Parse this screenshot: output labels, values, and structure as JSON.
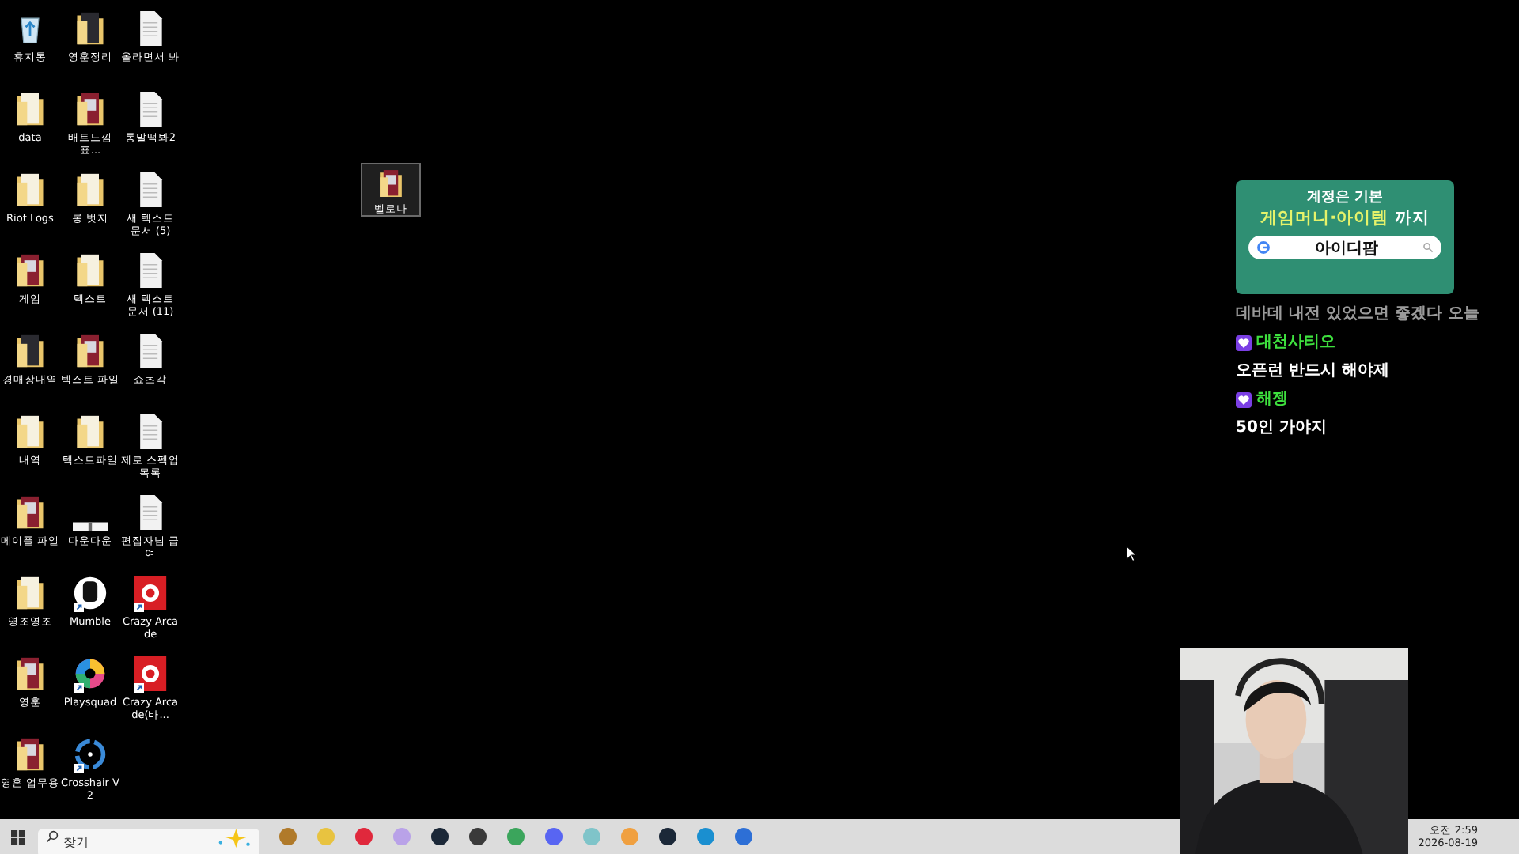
{
  "desktop_icons": [
    {
      "label": "휴지통",
      "kind": "recycle",
      "shortcut": false,
      "selected": false
    },
    {
      "label": "data",
      "kind": "folder",
      "shortcut": false,
      "selected": false
    },
    {
      "label": "Riot Logs",
      "kind": "folder",
      "shortcut": false,
      "selected": false
    },
    {
      "label": "게임",
      "kind": "photo-folder",
      "shortcut": false,
      "selected": false
    },
    {
      "label": "경매장내역",
      "kind": "dark-folder",
      "shortcut": false,
      "selected": false
    },
    {
      "label": "내역",
      "kind": "folder",
      "shortcut": false,
      "selected": false
    },
    {
      "label": "메이플 파일",
      "kind": "photo-folder",
      "shortcut": false,
      "selected": false
    },
    {
      "label": "영조영조",
      "kind": "folder",
      "shortcut": false,
      "selected": false
    },
    {
      "label": "영훈",
      "kind": "photo-folder",
      "shortcut": false,
      "selected": false
    },
    {
      "label": "영훈 업무용",
      "kind": "photo-folder",
      "shortcut": false,
      "selected": false
    },
    {
      "label": "영훈정리",
      "kind": "dark-folder",
      "shortcut": false,
      "selected": false
    },
    {
      "label": "배트느낌표...",
      "kind": "photo-folder",
      "shortcut": false,
      "selected": false
    },
    {
      "label": "롱 벗지",
      "kind": "folder",
      "shortcut": false,
      "selected": false
    },
    {
      "label": "텍스트",
      "kind": "folder",
      "shortcut": false,
      "selected": false
    },
    {
      "label": "텍스트 파일",
      "kind": "photo-folder",
      "shortcut": false,
      "selected": false
    },
    {
      "label": "텍스트파일",
      "kind": "folder",
      "shortcut": false,
      "selected": false
    },
    {
      "label": "다운다운",
      "kind": "bar",
      "shortcut": false,
      "selected": false
    },
    {
      "label": "Mumble",
      "kind": "mumble",
      "shortcut": true,
      "selected": false
    },
    {
      "label": "Playsquad",
      "kind": "playsquad",
      "shortcut": true,
      "selected": false
    },
    {
      "label": "Crosshair V2",
      "kind": "crosshair",
      "shortcut": true,
      "selected": false
    },
    {
      "label": "올라면서 봐",
      "kind": "text-file",
      "shortcut": false,
      "selected": false
    },
    {
      "label": "통말떡봐2",
      "kind": "text-file",
      "shortcut": false,
      "selected": false
    },
    {
      "label": "새 텍스트 문서 (5)",
      "kind": "text-file",
      "shortcut": false,
      "selected": false
    },
    {
      "label": "새 텍스트 문서 (11)",
      "kind": "text-file",
      "shortcut": false,
      "selected": false
    },
    {
      "label": "쇼츠각",
      "kind": "text-file",
      "shortcut": false,
      "selected": false
    },
    {
      "label": "제로 스펙업 목록",
      "kind": "text-file",
      "shortcut": false,
      "selected": false
    },
    {
      "label": "편집자님 급여",
      "kind": "text-file",
      "shortcut": false,
      "selected": false
    },
    {
      "label": "Crazy Arcade",
      "kind": "game",
      "shortcut": true,
      "selected": false
    },
    {
      "label": "Crazy Arcade(바...",
      "kind": "game",
      "shortcut": true,
      "selected": false
    }
  ],
  "loose_icon": {
    "label": "벨로나",
    "kind": "photo-folder",
    "selected": true
  },
  "ad": {
    "line1": "계정은 기본",
    "highlight": "게임머니·아이템",
    "line2_rest": "까지",
    "search_value": "아이디팜"
  },
  "chat": [
    {
      "kind": "text",
      "text": "데바데 내전 있었으면 좋겠다 오늘"
    },
    {
      "kind": "user",
      "text": "대천사티오"
    },
    {
      "kind": "text",
      "text": "오픈런 반드시 해야제"
    },
    {
      "kind": "user",
      "text": "해젱"
    },
    {
      "kind": "text",
      "text": "50인 가야지"
    }
  ],
  "taskbar": {
    "search_placeholder": "찾기",
    "apps": [
      {
        "color": "#b07a2a"
      },
      {
        "color": "#e8c340"
      },
      {
        "color": "#e0283c"
      },
      {
        "color": "#b9a2e8"
      },
      {
        "color": "#1b2838"
      },
      {
        "color": "#3a3a3a"
      },
      {
        "color": "#3ba55c"
      },
      {
        "color": "#5865f2"
      },
      {
        "color": "#7fc4c9"
      },
      {
        "color": "#f0a040"
      },
      {
        "color": "#1b2838"
      },
      {
        "color": "#1a8fd0"
      },
      {
        "color": "#2d6fd6"
      }
    ],
    "time": "오전 2:59",
    "date": "2026-08-19"
  }
}
